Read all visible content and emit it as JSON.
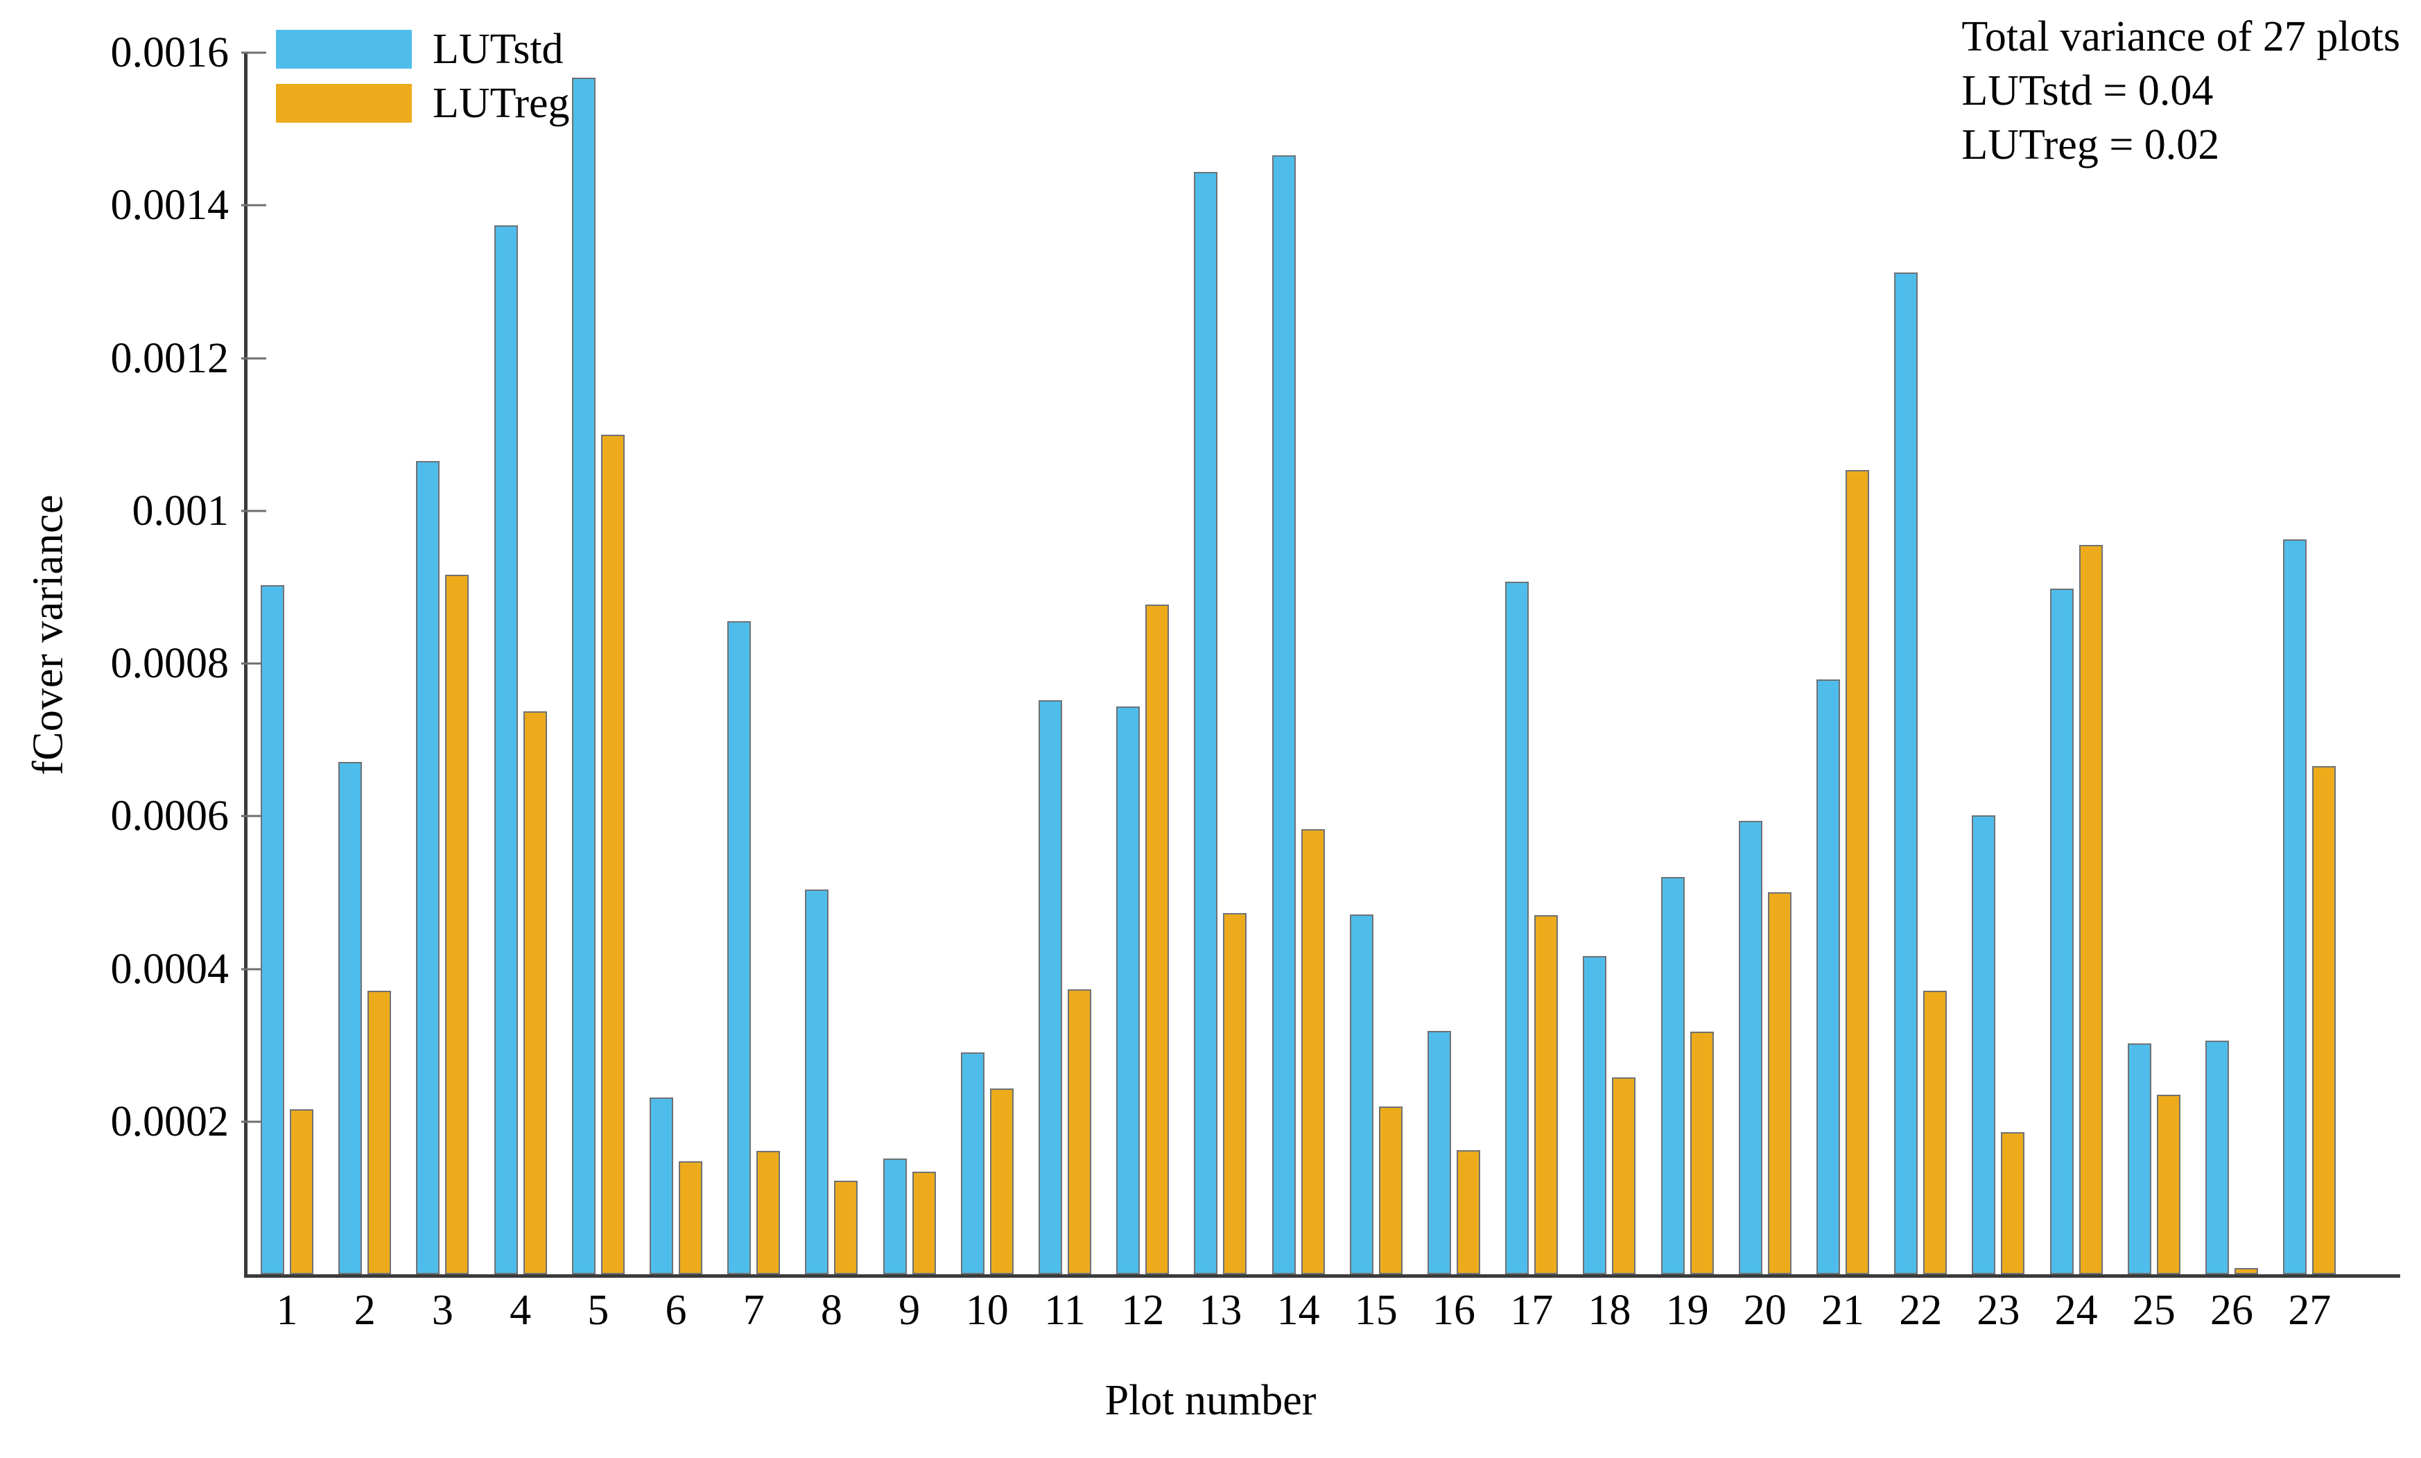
{
  "chart_data": {
    "type": "bar",
    "title": "",
    "xlabel": "Plot number",
    "ylabel": "fCover variance",
    "categories": [
      "1",
      "2",
      "3",
      "4",
      "5",
      "6",
      "7",
      "8",
      "9",
      "10",
      "11",
      "12",
      "13",
      "14",
      "15",
      "16",
      "17",
      "18",
      "19",
      "20",
      "21",
      "22",
      "23",
      "24",
      "25",
      "26",
      "27"
    ],
    "series": [
      {
        "name": "LUTstd",
        "color": "#4FBDEB",
        "values": [
          0.000903,
          0.000671,
          0.001065,
          0.001374,
          0.001567,
          0.000232,
          0.000855,
          0.000504,
          0.000152,
          0.000291,
          0.000752,
          0.000744,
          0.001444,
          0.001466,
          0.000471,
          0.000319,
          0.000907,
          0.000417,
          0.00052,
          0.000594,
          0.000779,
          0.001312,
          0.000601,
          0.000898,
          0.000302,
          0.000306,
          0.000963
        ]
      },
      {
        "name": "LUTreg",
        "color": "#EDAB1C",
        "values": [
          0.000216,
          0.000371,
          0.000916,
          0.000737,
          0.0011,
          0.000148,
          0.000162,
          0.000123,
          0.000134,
          0.000243,
          0.000373,
          0.000877,
          0.000473,
          0.000583,
          0.00022,
          0.000163,
          0.00047,
          0.000258,
          0.000318,
          0.0005,
          0.001053,
          0.000371,
          0.000186,
          0.000955,
          0.000235,
          8e-06,
          0.000666
        ]
      }
    ],
    "ylim": [
      0,
      0.0016
    ],
    "y_ticks": [
      0.0016,
      0.0014,
      0.0012,
      0.001,
      0.0008,
      0.0006,
      0.0004,
      0.0002
    ],
    "y_tick_labels": [
      "0.0016",
      "0.0014",
      "0.0012",
      "0.001",
      "0.0008",
      "0.0006",
      "0.0004",
      "0.0002"
    ],
    "grid": false,
    "legend_position": "top-left"
  },
  "legend": {
    "items": [
      {
        "label": "LUTstd",
        "color": "#4FBDEB"
      },
      {
        "label": "LUTreg",
        "color": "#EDAB1C"
      }
    ]
  },
  "annotation": {
    "line1": "Total variance of 27 plots",
    "line2": "LUTstd = 0.04",
    "line3": "LUTreg = 0.02"
  },
  "axes": {
    "x_title": "Plot number",
    "y_title": "fCover variance"
  }
}
